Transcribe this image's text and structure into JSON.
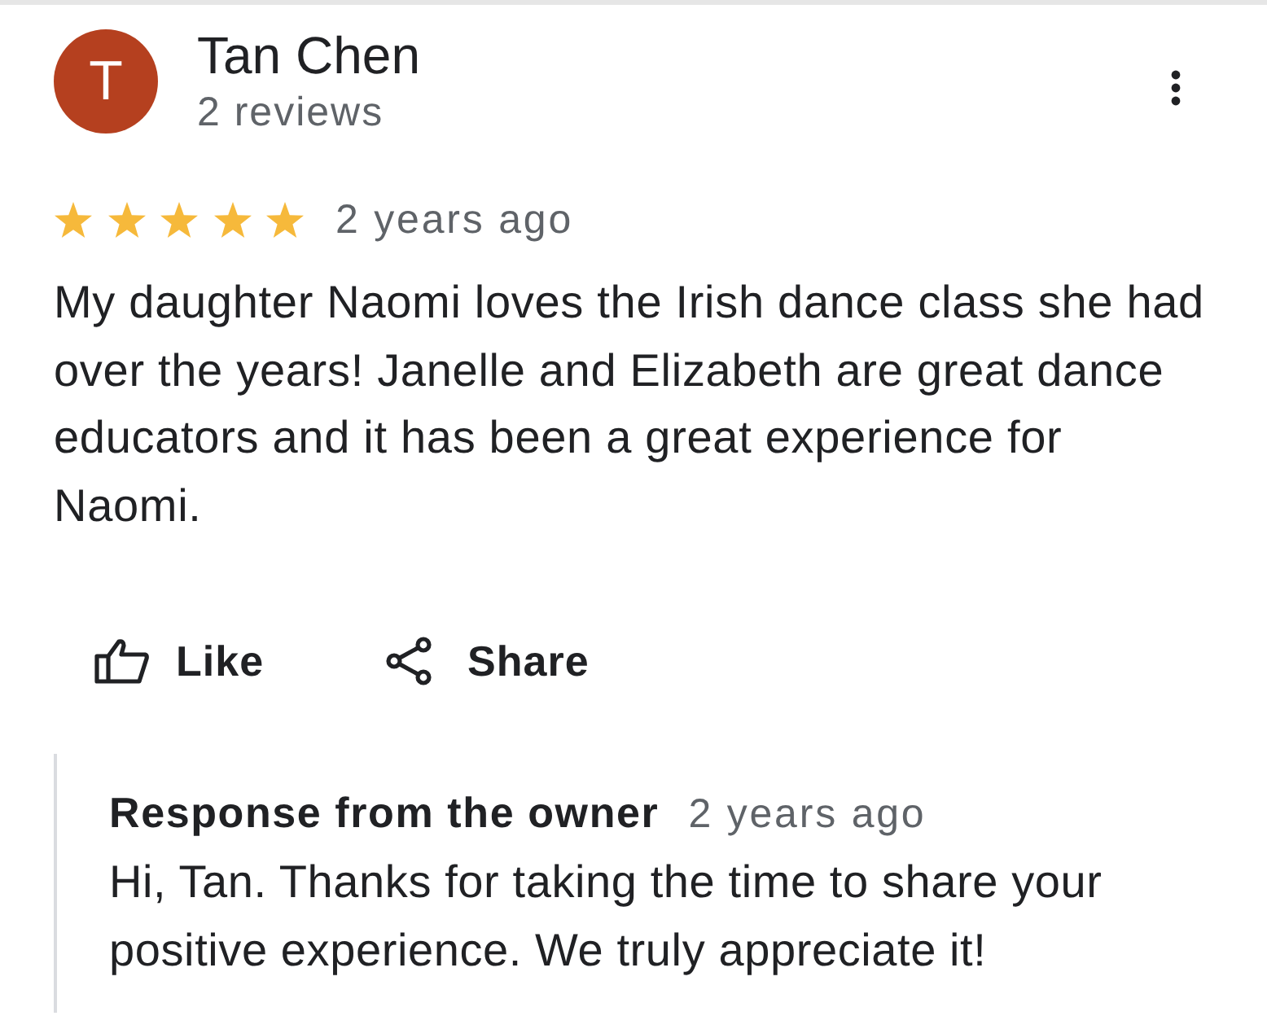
{
  "review": {
    "avatar": {
      "initial": "T"
    },
    "author_name": "Tan Chen",
    "author_meta": "2 reviews",
    "stars": 5,
    "time": "2 years ago",
    "text": "My daughter Naomi loves the Irish dance class she had over the years! Janelle and Elizabeth are great dance educators and it has been a great experience for Naomi.",
    "actions": [
      {
        "kind": "like",
        "label": "Like"
      },
      {
        "kind": "share",
        "label": "Share"
      }
    ]
  },
  "owner_response": {
    "title": "Response from the owner",
    "time": "2 years ago",
    "text": "Hi, Tan. Thanks for taking the time to share your positive experience. We truly appreciate it!"
  }
}
